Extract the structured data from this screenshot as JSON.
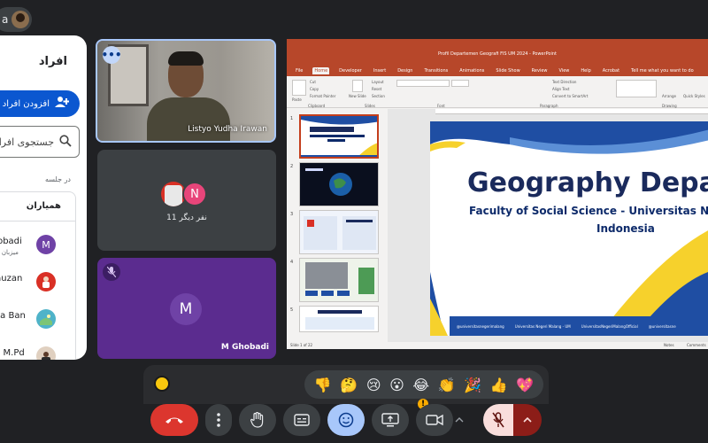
{
  "top_chip": {
    "label": "a"
  },
  "people_panel": {
    "title": "افراد",
    "add_people_label": "افزودن افراد",
    "search_placeholder": "جستجوی افراد",
    "in_meeting_label": "در جلسه",
    "contributors_title": "همیاران",
    "participants": [
      {
        "name": "Ghobadi",
        "role": "میزبان جلسه",
        "avatar_letter": "M",
        "avatar_color": "#6f42a6"
      },
      {
        "name": "r Fauzan",
        "role": "",
        "avatar_letter": "",
        "avatar_color": "#d93025"
      },
      {
        "name": "shka Ban",
        "role": "",
        "avatar_letter": "",
        "avatar_color": "#4fb3c9"
      },
      {
        "name": "zia, M.Pd",
        "role": "",
        "avatar_letter": "",
        "avatar_color": "#e0d0c0"
      }
    ]
  },
  "tiles": {
    "speaker_name": "Listyo Yudha Irawan",
    "others_label": "11 نفر دیگر",
    "others_avatar_letter": "N",
    "ghobadi_letter": "M",
    "ghobadi_name": "M Ghobadi"
  },
  "presentation": {
    "window_title": "Profil Departemen Geografi FIS UM 2024  -  PowerPoint",
    "menu": [
      "File",
      "Home",
      "Developer",
      "Insert",
      "Design",
      "Transitions",
      "Animations",
      "Slide Show",
      "Review",
      "View",
      "Help",
      "Acrobat",
      "Tell me what you want to do"
    ],
    "active_menu": "Home",
    "ribbon": {
      "paste": "Paste",
      "cut": "Cut",
      "copy": "Copy",
      "format_painter": "Format Painter",
      "new_slide": "New Slide",
      "layout": "Layout",
      "reset": "Reset",
      "section": "Section",
      "text_direction": "Text Direction",
      "align_text": "Align Text",
      "convert_smartart": "Convert to SmartArt",
      "arrange": "Arrange",
      "quick_styles": "Quick Styles",
      "groups": [
        "Clipboard",
        "Slides",
        "Font",
        "Paragraph",
        "Drawing"
      ]
    },
    "thumb_numbers": [
      "1",
      "2",
      "3",
      "4",
      "5"
    ],
    "slide_title": "Geography Depart",
    "slide_subtitle_line1": "Faculty of Social Science - Universitas Ne",
    "slide_subtitle_line2": "Indonesia",
    "footer_items": [
      "@universitasnegerimalang",
      "Universitas Negeri Malang - UM",
      "UniversitasNegeriMalangOfficial",
      "@universitasne"
    ],
    "status_left": "Slide 1 of 22",
    "status_notes": "Notes",
    "status_comments": "Comments"
  },
  "reactions": [
    "👎",
    "🤔",
    "😢",
    "😮",
    "😂",
    "👏",
    "🎉",
    "👍",
    "💖"
  ],
  "colors": {
    "accent_blue": "#0b57d0",
    "leave_red": "#dc362e",
    "ppt_orange": "#b7472a",
    "meet_bg": "#202124"
  }
}
